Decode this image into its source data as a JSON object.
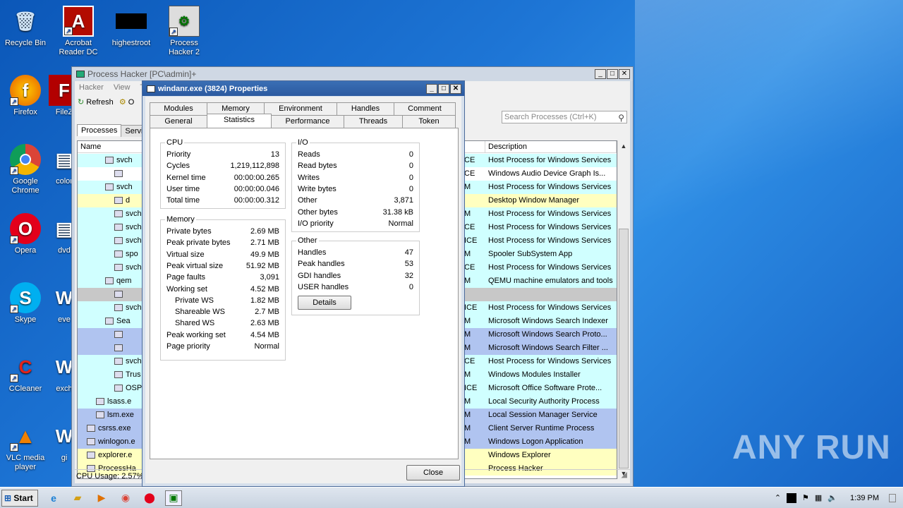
{
  "desktop": {
    "icons": [
      {
        "label": "Recycle Bin"
      },
      {
        "label": "Acrobat Reader DC"
      },
      {
        "label": "highestroot"
      },
      {
        "label": "Process Hacker 2"
      },
      {
        "label": "Firefox"
      },
      {
        "label": "FileZ"
      },
      {
        "label": "Google Chrome"
      },
      {
        "label": "color"
      },
      {
        "label": "Opera"
      },
      {
        "label": "dvd"
      },
      {
        "label": "Skype"
      },
      {
        "label": "eve"
      },
      {
        "label": "CCleaner"
      },
      {
        "label": "exch"
      },
      {
        "label": "VLC media player"
      },
      {
        "label": "gi"
      }
    ]
  },
  "main_window": {
    "title": "Process Hacker [PC\\admin]+",
    "menu": [
      "Hacker",
      "View",
      "To"
    ],
    "toolbar": {
      "refresh": "Refresh",
      "options": "O"
    },
    "search_placeholder": "Search Processes (Ctrl+K)",
    "tabs": [
      "Processes",
      "Servic"
    ],
    "columns": {
      "name": "Name",
      "description": "Description"
    },
    "rows": [
      {
        "name": "svch",
        "mid": "CE",
        "desc": "Host Process for Windows Services",
        "color": "#d0ffff"
      },
      {
        "name": "",
        "mid": "CE",
        "desc": "Windows Audio Device Graph Is...",
        "color": "#ffffff"
      },
      {
        "name": "svch",
        "mid": "M",
        "desc": "Host Process for Windows Services",
        "color": "#d0ffff"
      },
      {
        "name": "d",
        "mid": "",
        "desc": "Desktop Window Manager",
        "color": "#ffffc0"
      },
      {
        "name": "svch",
        "mid": "M",
        "desc": "Host Process for Windows Services",
        "color": "#d0ffff"
      },
      {
        "name": "svch",
        "mid": "CE",
        "desc": "Host Process for Windows Services",
        "color": "#d0ffff"
      },
      {
        "name": "svch",
        "mid": "ICE",
        "desc": "Host Process for Windows Services",
        "color": "#d0ffff"
      },
      {
        "name": "spo",
        "mid": "M",
        "desc": "Spooler SubSystem App",
        "color": "#d0ffff"
      },
      {
        "name": "svch",
        "mid": "CE",
        "desc": "Host Process for Windows Services",
        "color": "#d0ffff"
      },
      {
        "name": "qem",
        "mid": "M",
        "desc": "QEMU machine emulators and tools",
        "color": "#d0ffff"
      },
      {
        "name": "",
        "mid": "",
        "desc": "",
        "color": "#c8c8c8"
      },
      {
        "name": "svch",
        "mid": "ICE",
        "desc": "Host Process for Windows Services",
        "color": "#d0ffff"
      },
      {
        "name": "Sea",
        "mid": "M",
        "desc": "Microsoft Windows Search Indexer",
        "color": "#d0ffff"
      },
      {
        "name": "",
        "mid": "M",
        "desc": "Microsoft Windows Search Proto...",
        "color": "#b0c4f0"
      },
      {
        "name": "",
        "mid": "M",
        "desc": "Microsoft Windows Search Filter ...",
        "color": "#b0c4f0"
      },
      {
        "name": "svch",
        "mid": "CE",
        "desc": "Host Process for Windows Services",
        "color": "#d0ffff"
      },
      {
        "name": "Trus",
        "mid": "M",
        "desc": "Windows Modules Installer",
        "color": "#d0ffff"
      },
      {
        "name": "OSP",
        "mid": "ICE",
        "desc": "Microsoft Office Software Prote...",
        "color": "#d0ffff"
      },
      {
        "name": "lsass.e",
        "mid": "M",
        "desc": "Local Security Authority Process",
        "color": "#d0ffff"
      },
      {
        "name": "lsm.exe",
        "mid": "M",
        "desc": "Local Session Manager Service",
        "color": "#b0c4f0"
      },
      {
        "name": "csrss.exe",
        "mid": "M",
        "desc": "Client Server Runtime Process",
        "color": "#b0c4f0"
      },
      {
        "name": "winlogon.e",
        "mid": "M",
        "desc": "Windows Logon Application",
        "color": "#b0c4f0"
      },
      {
        "name": "explorer.e",
        "mid": "",
        "desc": "Windows Explorer",
        "color": "#ffffc0"
      },
      {
        "name": "ProcessHa",
        "mid": "",
        "desc": "Process Hacker",
        "color": "#ffffc0"
      }
    ],
    "status": "CPU Usage: 2.57%"
  },
  "props": {
    "title": "windanr.exe (3824) Properties",
    "tabs_row1": [
      "Modules",
      "Memory",
      "Environment",
      "Handles",
      "Comment"
    ],
    "tabs_row2": [
      "General",
      "Statistics",
      "Performance",
      "Threads",
      "Token"
    ],
    "cpu": {
      "title": "CPU",
      "rows": [
        {
          "k": "Priority",
          "v": "13"
        },
        {
          "k": "Cycles",
          "v": "1,219,112,898"
        },
        {
          "k": "Kernel time",
          "v": "00:00:00.265"
        },
        {
          "k": "User time",
          "v": "00:00:00.046"
        },
        {
          "k": "Total time",
          "v": "00:00:00.312"
        }
      ]
    },
    "io": {
      "title": "I/O",
      "rows": [
        {
          "k": "Reads",
          "v": "0"
        },
        {
          "k": "Read bytes",
          "v": "0"
        },
        {
          "k": "Writes",
          "v": "0"
        },
        {
          "k": "Write bytes",
          "v": "0"
        },
        {
          "k": "Other",
          "v": "3,871"
        },
        {
          "k": "Other bytes",
          "v": "31.38 kB"
        },
        {
          "k": "I/O priority",
          "v": "Normal"
        }
      ]
    },
    "memory": {
      "title": "Memory",
      "rows": [
        {
          "k": "Private bytes",
          "v": "2.69 MB"
        },
        {
          "k": "Peak private bytes",
          "v": "2.71 MB"
        },
        {
          "k": "Virtual size",
          "v": "49.9 MB"
        },
        {
          "k": "Peak virtual size",
          "v": "51.92 MB"
        },
        {
          "k": "Page faults",
          "v": "3,091"
        },
        {
          "k": "Working set",
          "v": "4.52 MB"
        },
        {
          "k": "Private WS",
          "v": "1.82 MB"
        },
        {
          "k": "Shareable WS",
          "v": "2.7 MB"
        },
        {
          "k": "Shared WS",
          "v": "2.63 MB"
        },
        {
          "k": "Peak working set",
          "v": "4.54 MB"
        },
        {
          "k": "Page priority",
          "v": "Normal"
        }
      ]
    },
    "other": {
      "title": "Other",
      "rows": [
        {
          "k": "Handles",
          "v": "47"
        },
        {
          "k": "Peak handles",
          "v": "53"
        },
        {
          "k": "GDI handles",
          "v": "32"
        },
        {
          "k": "USER handles",
          "v": "0"
        }
      ],
      "details": "Details"
    },
    "close": "Close"
  },
  "taskbar": {
    "start": "Start",
    "time": "1:39 PM"
  },
  "watermark": "ANY RUN"
}
